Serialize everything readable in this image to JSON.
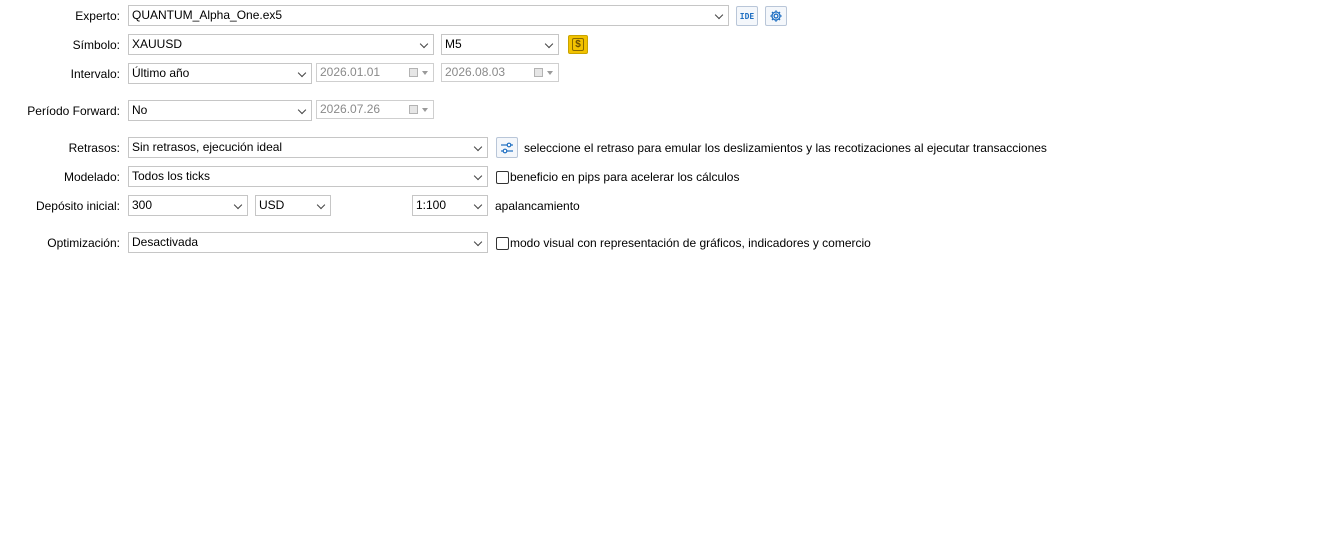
{
  "expert": {
    "label": "Experto:",
    "value": "QUANTUM_Alpha_One.ex5",
    "ide_label": "IDE"
  },
  "symbol": {
    "label": "Símbolo:",
    "value": "XAUUSD",
    "timeframe": "M5",
    "currency_icon": "$"
  },
  "interval": {
    "label": "Intervalo:",
    "value": "Último año",
    "from": "2026.01.01",
    "to": "2026.08.03"
  },
  "forward": {
    "label": "Período Forward:",
    "value": "No",
    "date": "2026.07.26"
  },
  "delays": {
    "label": "Retrasos:",
    "value": "Sin retrasos, ejecución ideal",
    "hint": "seleccione el retraso para emular los deslizamientos y las recotizaciones al ejecutar transacciones"
  },
  "modeling": {
    "label": "Modelado:",
    "value": "Todos los ticks",
    "checkbox_label": "beneficio en pips para acelerar los cálculos",
    "checked": false
  },
  "deposit": {
    "label": "Depósito inicial:",
    "amount": "300",
    "currency": "USD",
    "leverage": "1:100",
    "leverage_label": "apalancamiento"
  },
  "optimization": {
    "label": "Optimización:",
    "value": "Desactivada",
    "checkbox_label": "modo visual con representación de gráficos, indicadores y comercio",
    "checked": false
  },
  "colors": {
    "accent": "#1f6fc2",
    "coin": "#f2c200",
    "border": "#c6c6c6"
  }
}
